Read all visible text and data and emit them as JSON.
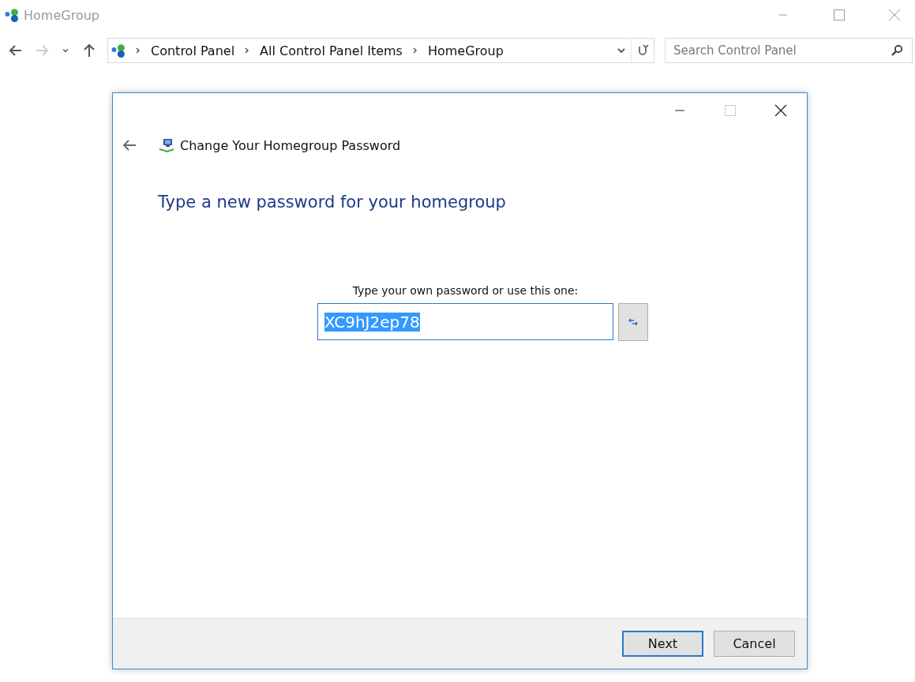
{
  "window": {
    "title": "HomeGroup"
  },
  "nav_buttons": [
    {
      "kind": "back",
      "disabled": false
    },
    {
      "kind": "forward",
      "disabled": true
    },
    {
      "kind": "recent",
      "disabled": false
    },
    {
      "kind": "up",
      "disabled": false
    }
  ],
  "breadcrumb": [
    "Control Panel",
    "All Control Panel Items",
    "HomeGroup"
  ],
  "search": {
    "placeholder": "Search Control Panel"
  },
  "dialog": {
    "title": "Change Your Homegroup Password",
    "heading": "Type a new password for your homegroup",
    "prompt": "Type your own password or use this one:",
    "password": {
      "value": "XC9hJ2ep78",
      "selected": true
    },
    "buttons": [
      {
        "label": "Next",
        "default": true
      },
      {
        "label": "Cancel",
        "default": false
      }
    ]
  }
}
